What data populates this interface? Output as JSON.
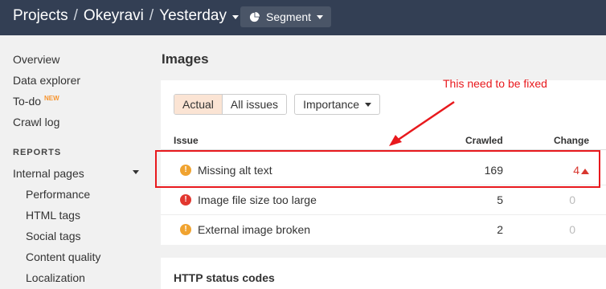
{
  "header": {
    "breadcrumbs": [
      "Projects",
      "Okeyravi",
      "Yesterday"
    ],
    "separator": "/",
    "segment_label": "Segment"
  },
  "sidebar": {
    "items": [
      {
        "label": "Overview"
      },
      {
        "label": "Data explorer"
      },
      {
        "label": "To-do",
        "badge": "NEW"
      },
      {
        "label": "Crawl log"
      }
    ],
    "section_heading": "REPORTS",
    "group_label": "Internal pages",
    "sub_items": [
      "Performance",
      "HTML tags",
      "Social tags",
      "Content quality",
      "Localization"
    ]
  },
  "main": {
    "title": "Images",
    "filters": {
      "actual": "Actual",
      "all_issues": "All issues",
      "importance": "Importance"
    },
    "columns": {
      "issue": "Issue",
      "crawled": "Crawled",
      "change": "Change"
    },
    "rows": [
      {
        "issue": "Missing alt text",
        "severity": "warning",
        "crawled": "169",
        "change": "4",
        "trend": "up"
      },
      {
        "issue": "Image file size too large",
        "severity": "error",
        "crawled": "5",
        "change": "0"
      },
      {
        "issue": "External image broken",
        "severity": "warning",
        "crawled": "2",
        "change": "0"
      }
    ],
    "annotation": "This need to be fixed",
    "next_section_title": "HTTP status codes"
  },
  "colors": {
    "header_bg": "#333f54",
    "accent_annotation": "#e8191d",
    "warning": "#f0a330",
    "error": "#e2372f",
    "active_filter": "#fbe4d4"
  }
}
